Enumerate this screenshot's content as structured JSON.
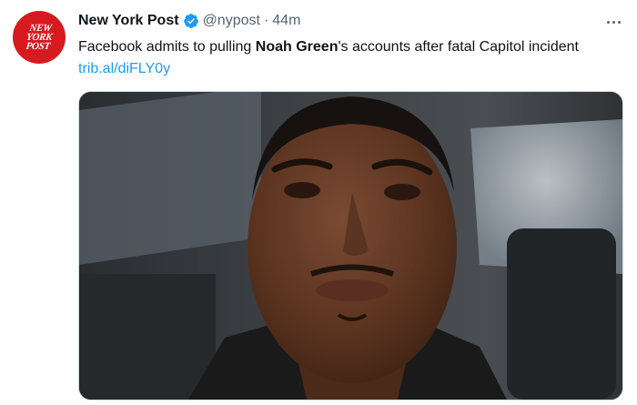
{
  "tweet": {
    "author_name": "New York Post",
    "handle": "@nypost",
    "separator": "·",
    "time": "44m",
    "avatar_logo": "NEW YORK POST",
    "text_prefix": "Facebook admits to pulling ",
    "text_bold": "Noah Green",
    "text_suffix": "'s accounts after fatal Capitol incident ",
    "link": "trib.al/diFLY0y",
    "media_icon": "photo-of-man-in-car",
    "verified_icon": "verified-badge-icon",
    "more_icon": "more-options-icon"
  },
  "colors": {
    "link": "#1d9bf0",
    "verified": "#1d9bf0",
    "secondary_text": "#536471",
    "avatar_bg": "#d71920"
  }
}
